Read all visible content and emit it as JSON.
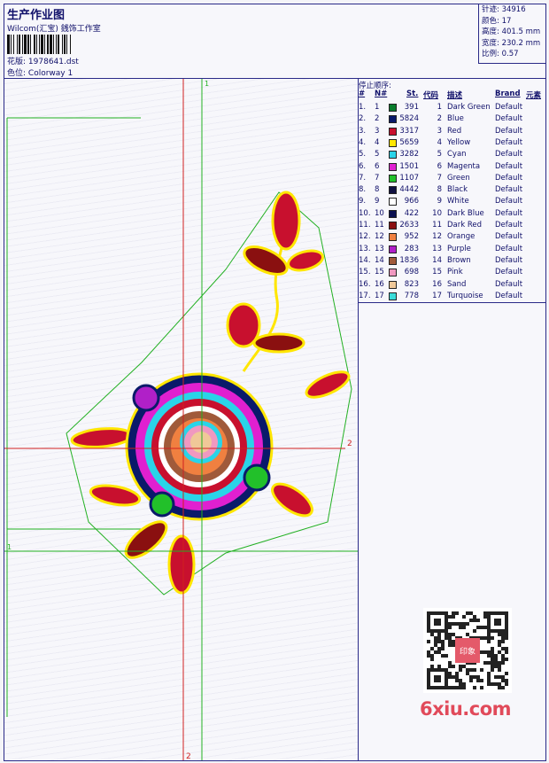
{
  "header": {
    "title": "生产作业图",
    "company": "Wilcom(汇宝) 銭饰工作室",
    "pattern_label": "花版:",
    "pattern_value": "1978641.dst",
    "colorway_label": "色位:",
    "colorway_value": "Colorway 1"
  },
  "info": {
    "stitches_label": "针迹:",
    "stitches_value": "34916",
    "colors_label": "颜色:",
    "colors_value": "17",
    "height_label": "高度:",
    "height_value": "401.5 mm",
    "width_label": "宽度:",
    "width_value": "230.2 mm",
    "scale_label": "比例:",
    "scale_value": "0.57"
  },
  "stop_sequence": {
    "title": "停止顺序:",
    "headers": {
      "hash": "#",
      "num": "N#",
      "stitches": "St.",
      "code": "代码",
      "description": "描述",
      "brand": "Brand",
      "element": "元素"
    },
    "rows": [
      {
        "idx": "1.",
        "num": "1",
        "st": "391",
        "code": "1",
        "desc": "Dark Green",
        "brand": "Default",
        "color": "#0a7d2c"
      },
      {
        "idx": "2.",
        "num": "2",
        "st": "5824",
        "code": "2",
        "desc": "Blue",
        "brand": "Default",
        "color": "#0a1a6a"
      },
      {
        "idx": "3.",
        "num": "3",
        "st": "3317",
        "code": "3",
        "desc": "Red",
        "brand": "Default",
        "color": "#c8102e"
      },
      {
        "idx": "4.",
        "num": "4",
        "st": "5659",
        "code": "4",
        "desc": "Yellow",
        "brand": "Default",
        "color": "#ffe600"
      },
      {
        "idx": "5.",
        "num": "5",
        "st": "3282",
        "code": "5",
        "desc": "Cyan",
        "brand": "Default",
        "color": "#2ad4e8"
      },
      {
        "idx": "6.",
        "num": "6",
        "st": "1501",
        "code": "6",
        "desc": "Magenta",
        "brand": "Default",
        "color": "#e020d0"
      },
      {
        "idx": "7.",
        "num": "7",
        "st": "1107",
        "code": "7",
        "desc": "Green",
        "brand": "Default",
        "color": "#22c02a"
      },
      {
        "idx": "8.",
        "num": "8",
        "st": "4442",
        "code": "8",
        "desc": "Black",
        "brand": "Default",
        "color": "#101040"
      },
      {
        "idx": "9.",
        "num": "9",
        "st": "966",
        "code": "9",
        "desc": "White",
        "brand": "Default",
        "color": "#ffffff"
      },
      {
        "idx": "10.",
        "num": "10",
        "st": "422",
        "code": "10",
        "desc": "Dark Blue",
        "brand": "Default",
        "color": "#0a1050"
      },
      {
        "idx": "11.",
        "num": "11",
        "st": "2633",
        "code": "11",
        "desc": "Dark Red",
        "brand": "Default",
        "color": "#8a1010"
      },
      {
        "idx": "12.",
        "num": "12",
        "st": "952",
        "code": "12",
        "desc": "Orange",
        "brand": "Default",
        "color": "#f08040"
      },
      {
        "idx": "13.",
        "num": "13",
        "st": "283",
        "code": "13",
        "desc": "Purple",
        "brand": "Default",
        "color": "#b020c8"
      },
      {
        "idx": "14.",
        "num": "14",
        "st": "1836",
        "code": "14",
        "desc": "Brown",
        "brand": "Default",
        "color": "#a05a3a"
      },
      {
        "idx": "15.",
        "num": "15",
        "st": "698",
        "code": "15",
        "desc": "Pink",
        "brand": "Default",
        "color": "#f098c0"
      },
      {
        "idx": "16.",
        "num": "16",
        "st": "823",
        "code": "16",
        "desc": "Sand",
        "brand": "Default",
        "color": "#f0c898"
      },
      {
        "idx": "17.",
        "num": "17",
        "st": "778",
        "code": "17",
        "desc": "Turquoise",
        "brand": "Default",
        "color": "#3adcd8"
      }
    ]
  },
  "guides": {
    "v_red_top": "1",
    "v_red_bottom": "2",
    "h_red_right": "2",
    "h_green_left": "1"
  },
  "watermark": "6xiu.com",
  "qr_badge": "印象"
}
